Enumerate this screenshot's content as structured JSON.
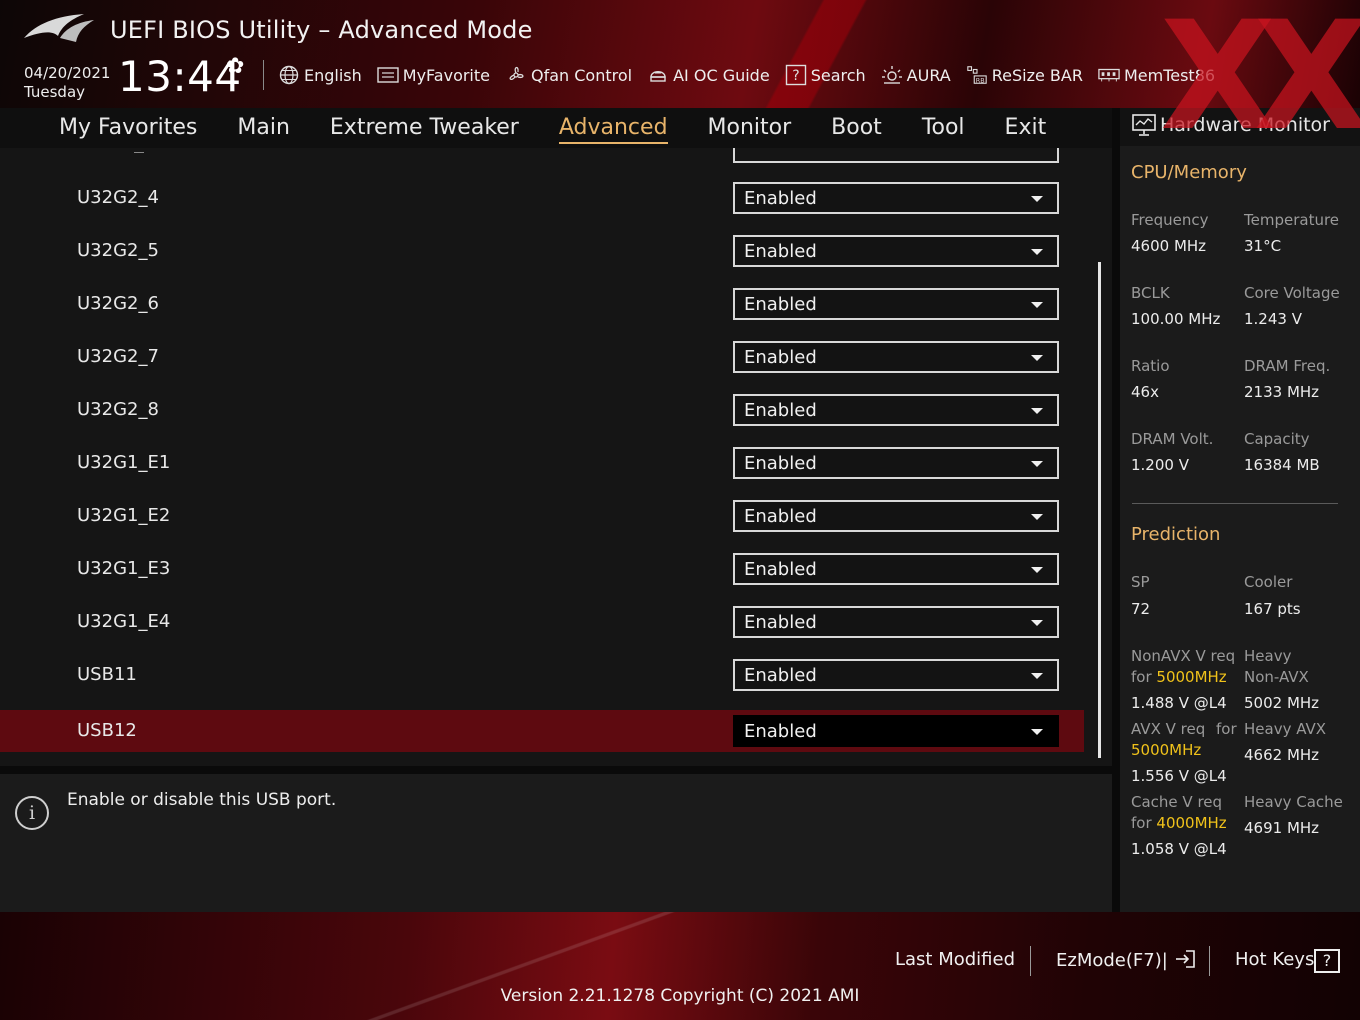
{
  "header": {
    "title": "UEFI BIOS Utility – Advanced Mode",
    "date": "04/20/2021",
    "day": "Tuesday",
    "time": "13:44",
    "tools": [
      {
        "label": "English",
        "icon": "globe-icon"
      },
      {
        "label": "MyFavorite",
        "icon": "favorite-list-icon"
      },
      {
        "label": "Qfan Control",
        "icon": "fan-icon"
      },
      {
        "label": "AI OC Guide",
        "icon": "ai-chip-icon"
      },
      {
        "label": "Search",
        "icon": "search-help-icon"
      },
      {
        "label": "AURA",
        "icon": "aura-light-icon"
      },
      {
        "label": "ReSize BAR",
        "icon": "resize-bar-icon"
      },
      {
        "label": "MemTest86",
        "icon": "memory-icon"
      }
    ]
  },
  "nav": {
    "tabs": [
      "My Favorites",
      "Main",
      "Extreme Tweaker",
      "Advanced",
      "Monitor",
      "Boot",
      "Tool",
      "Exit"
    ],
    "active": "Advanced"
  },
  "settings": [
    {
      "label": "U32G2_4",
      "value": "Enabled"
    },
    {
      "label": "U32G2_5",
      "value": "Enabled"
    },
    {
      "label": "U32G2_6",
      "value": "Enabled"
    },
    {
      "label": "U32G2_7",
      "value": "Enabled"
    },
    {
      "label": "U32G2_8",
      "value": "Enabled"
    },
    {
      "label": "U32G1_E1",
      "value": "Enabled"
    },
    {
      "label": "U32G1_E2",
      "value": "Enabled"
    },
    {
      "label": "U32G1_E3",
      "value": "Enabled"
    },
    {
      "label": "U32G1_E4",
      "value": "Enabled"
    },
    {
      "label": "USB11",
      "value": "Enabled"
    },
    {
      "label": "USB12",
      "value": "Enabled",
      "selected": true
    }
  ],
  "help": {
    "text": "Enable or disable this USB port."
  },
  "hardware_monitor": {
    "title": "Hardware Monitor",
    "cpu_memory": {
      "title": "CPU/Memory",
      "items": [
        {
          "label": "Frequency",
          "value": "4600 MHz"
        },
        {
          "label": "Temperature",
          "value": "31°C"
        },
        {
          "label": "BCLK",
          "value": "100.00 MHz"
        },
        {
          "label": "Core Voltage",
          "value": "1.243 V"
        },
        {
          "label": "Ratio",
          "value": "46x"
        },
        {
          "label": "DRAM Freq.",
          "value": "2133 MHz"
        },
        {
          "label": "DRAM Volt.",
          "value": "1.200 V"
        },
        {
          "label": "Capacity",
          "value": "16384 MB"
        }
      ]
    },
    "prediction": {
      "title": "Prediction",
      "sp_label": "SP",
      "sp_value": "72",
      "cooler_label": "Cooler",
      "cooler_value": "167 pts",
      "nonavx_label": "NonAVX V req",
      "nonavx_for": "for",
      "nonavx_freq": "5000MHz",
      "nonavx_value": "1.488 V @L4",
      "heavy_nonavx_label1": "Heavy",
      "heavy_nonavx_label2": "Non-AVX",
      "heavy_nonavx_value": "5002 MHz",
      "avx_label": "AVX V req",
      "avx_for": "for",
      "avx_freq": "5000MHz",
      "avx_value": "1.556 V @L4",
      "heavy_avx_label": "Heavy AVX",
      "heavy_avx_value": "4662 MHz",
      "cache_label": "Cache V req",
      "cache_for": "for",
      "cache_freq": "4000MHz",
      "cache_value": "1.058 V @L4",
      "heavy_cache_label": "Heavy Cache",
      "heavy_cache_value": "4691 MHz"
    }
  },
  "footer": {
    "last_modified": "Last Modified",
    "ezmode": "EzMode(F7)|",
    "hotkeys": "Hot Keys",
    "hotkeys_key": "?",
    "version": "Version 2.21.1278 Copyright (C) 2021 AMI"
  },
  "colors": {
    "accent": "#e8b46a",
    "selected_row": "#5e0a10",
    "highlight": "#f0c21a"
  }
}
